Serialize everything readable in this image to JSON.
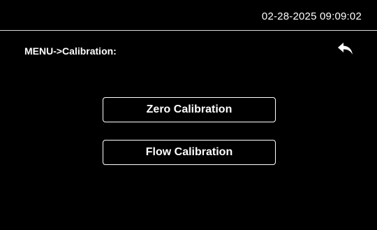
{
  "status_bar": {
    "datetime": "02-28-2025 09:09:02"
  },
  "header": {
    "title": "MENU->Calibration:",
    "back_icon": "back-arrow-icon"
  },
  "menu": {
    "items": [
      {
        "label": "Zero Calibration"
      },
      {
        "label": "Flow Calibration"
      }
    ]
  },
  "colors": {
    "background": "#000000",
    "foreground": "#ffffff",
    "divider": "#d8d8d8"
  }
}
